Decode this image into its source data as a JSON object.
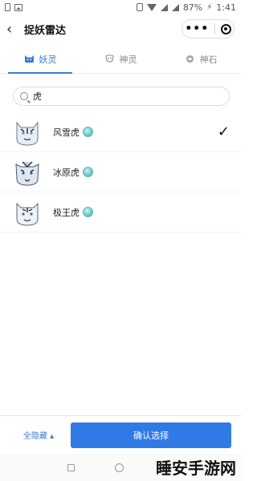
{
  "statusbar": {
    "battery": "87%",
    "time": "1:41"
  },
  "navbar": {
    "title": "捉妖雷达",
    "more": "•••"
  },
  "tabs": [
    {
      "label": "妖灵",
      "active": true,
      "icon": "cat-face-icon"
    },
    {
      "label": "神灵",
      "active": false,
      "icon": "mask-icon"
    },
    {
      "label": "神石",
      "active": false,
      "icon": "stone-icon"
    }
  ],
  "search": {
    "value": "虎"
  },
  "list": [
    {
      "name": "风雪虎",
      "checked": true
    },
    {
      "name": "冰原虎",
      "checked": false
    },
    {
      "name": "极王虎",
      "checked": false
    }
  ],
  "bottom": {
    "hide_all": "全隐藏 ▴",
    "confirm": "确认选择"
  },
  "watermark": "睡安手游网",
  "colors": {
    "accent": "#2f7ae5",
    "gem": "#6cc8c6"
  }
}
